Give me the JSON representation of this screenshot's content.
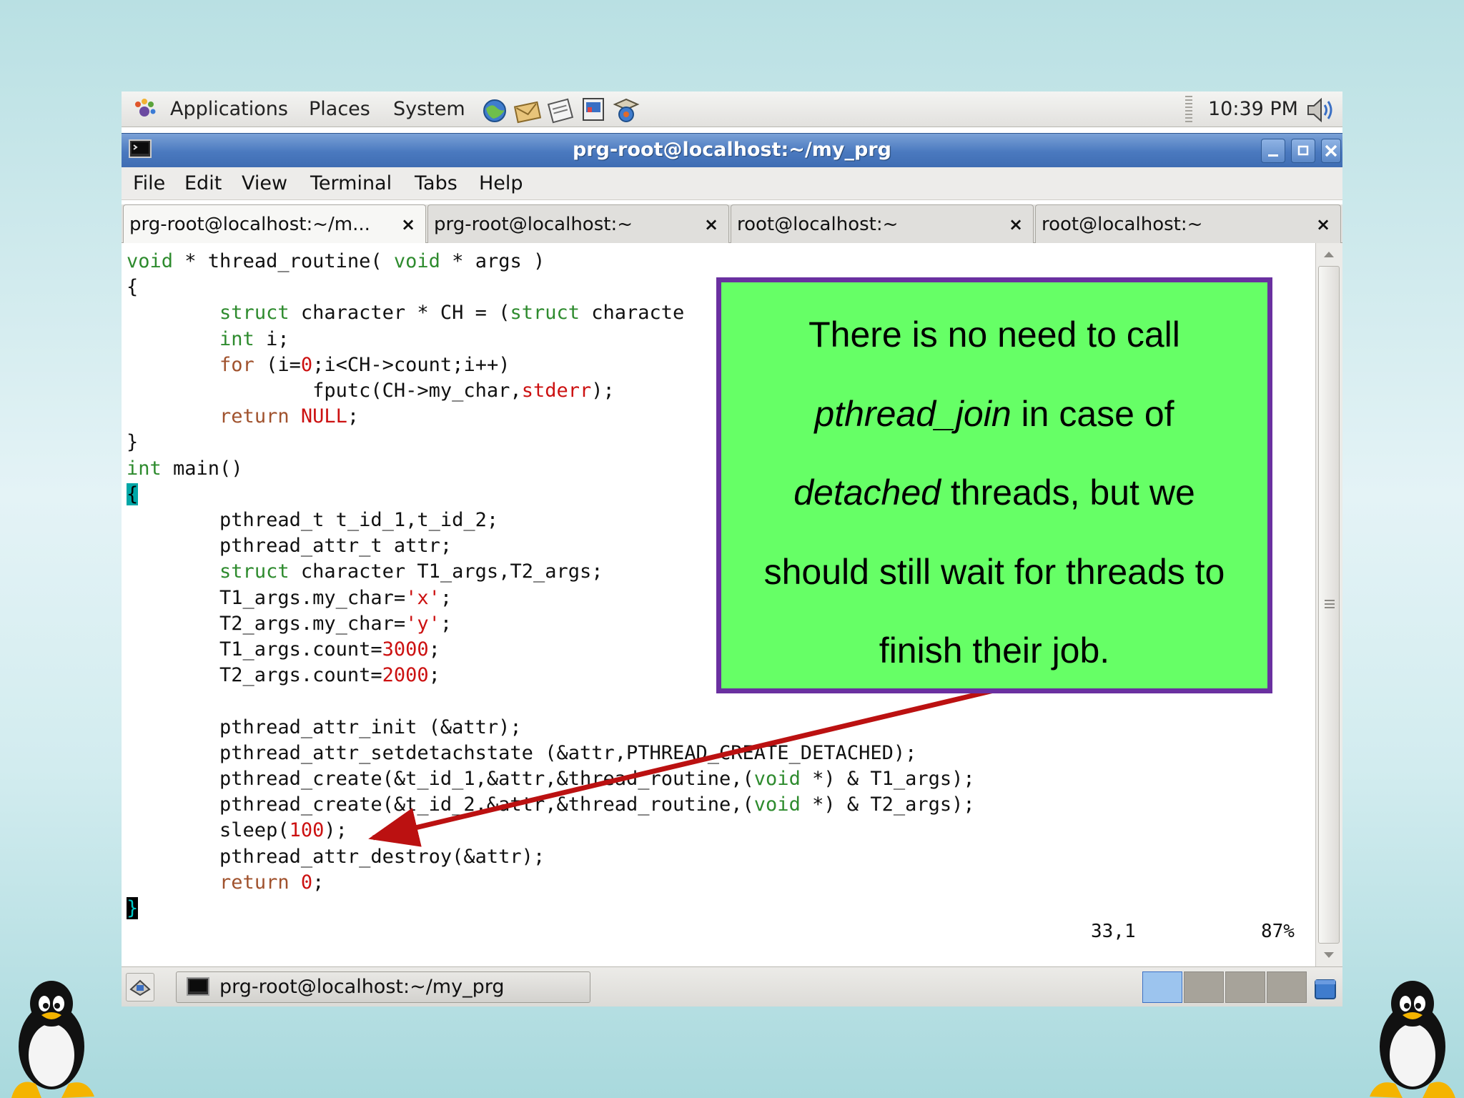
{
  "top_panel": {
    "menus": [
      "Applications",
      "Places",
      "System"
    ],
    "clock": "10:39 PM"
  },
  "window": {
    "title": "prg-root@localhost:~/my_prg"
  },
  "menubar": {
    "items": [
      "File",
      "Edit",
      "View",
      "Terminal",
      "Tabs",
      "Help"
    ]
  },
  "tabs": [
    {
      "label": "prg-root@localhost:~/m...",
      "close": "×"
    },
    {
      "label": "prg-root@localhost:~",
      "close": "×"
    },
    {
      "label": "root@localhost:~",
      "close": "×"
    },
    {
      "label": "root@localhost:~",
      "close": "×"
    }
  ],
  "code": {
    "l1": [
      "void",
      " * thread_routine( ",
      "void",
      " * args )"
    ],
    "l2": "{",
    "l3": [
      "        ",
      "struct",
      " character * CH = (",
      "struct",
      " characte"
    ],
    "l4": [
      "        ",
      "int",
      " i;"
    ],
    "l5": [
      "        ",
      "for",
      " (i=",
      "0",
      ";i<CH->count;i++)"
    ],
    "l6": [
      "                fputc(CH->my_char,",
      "stderr",
      ");"
    ],
    "l7": [
      "        ",
      "return",
      " ",
      "NULL",
      ";"
    ],
    "l8": "}",
    "l9": [
      "int",
      " main()"
    ],
    "l10": "{",
    "l11": "        pthread_t t_id_1,t_id_2;",
    "l12": "        pthread_attr_t attr;",
    "l13": [
      "        ",
      "struct",
      " character T1_args,T2_args;"
    ],
    "l14": [
      "        T1_args.my_char=",
      "'x'",
      ";"
    ],
    "l15": [
      "        T2_args.my_char=",
      "'y'",
      ";"
    ],
    "l16": [
      "        T1_args.count=",
      "3000",
      ";"
    ],
    "l17": [
      "        T2_args.count=",
      "2000",
      ";"
    ],
    "l18": "",
    "l19": "        pthread_attr_init (&attr);",
    "l20": "        pthread_attr_setdetachstate (&attr,PTHREAD_CREATE_DETACHED);",
    "l21": [
      "        pthread_create(&t_id_1,&attr,&thread_routine,(",
      "void",
      " *) & T1_args);"
    ],
    "l22": [
      "        pthread_create(&t_id_2,&attr,&thread_routine,(",
      "void",
      " *) & T2_args);"
    ],
    "l23": [
      "        sleep(",
      "100",
      ");"
    ],
    "l24": "        pthread_attr_destroy(&attr);",
    "l25": [
      "        ",
      "return",
      " ",
      "0",
      ";"
    ],
    "l26": "}"
  },
  "status": {
    "position": "33,1",
    "percent": "87%"
  },
  "taskbar": {
    "window_button": "prg-root@localhost:~/my_prg"
  },
  "callout": {
    "line1": "There is no need to call",
    "line2_em": "pthread_join",
    "line2_rest": "  in case of",
    "line3_em": "detached",
    "line3_rest": "  threads, but we",
    "line4": "should still wait for threads to",
    "line5": "finish their job."
  },
  "colors": {
    "callout_fill": "#66ff66",
    "callout_border": "#6a30a0",
    "arrow": "#bb1111"
  }
}
